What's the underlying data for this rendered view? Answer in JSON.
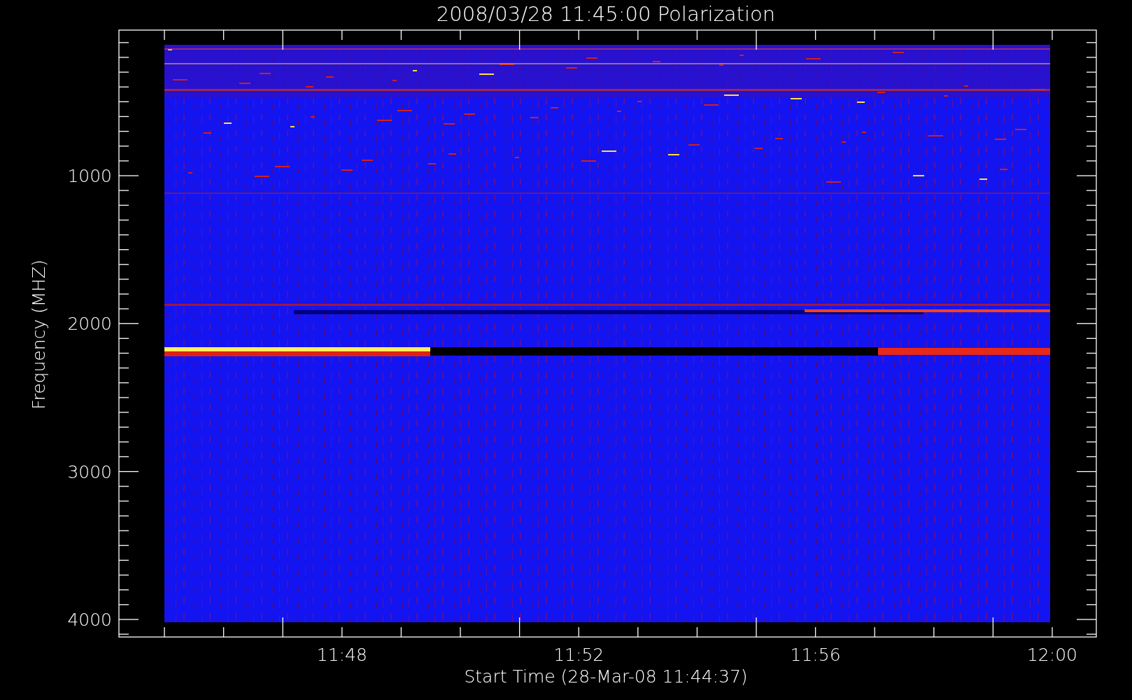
{
  "plot": {
    "title": "2008/03/28 11:45:00 Polarization",
    "y_axis": {
      "label": "Frequency (MHZ)",
      "ticks": [
        "1000",
        "2000",
        "3000",
        "4000"
      ]
    },
    "x_axis": {
      "label": "Start Time (28-Mar-08 11:44:37)",
      "ticks": [
        "11:48",
        "11:52",
        "11:56",
        "12:00"
      ]
    }
  }
}
